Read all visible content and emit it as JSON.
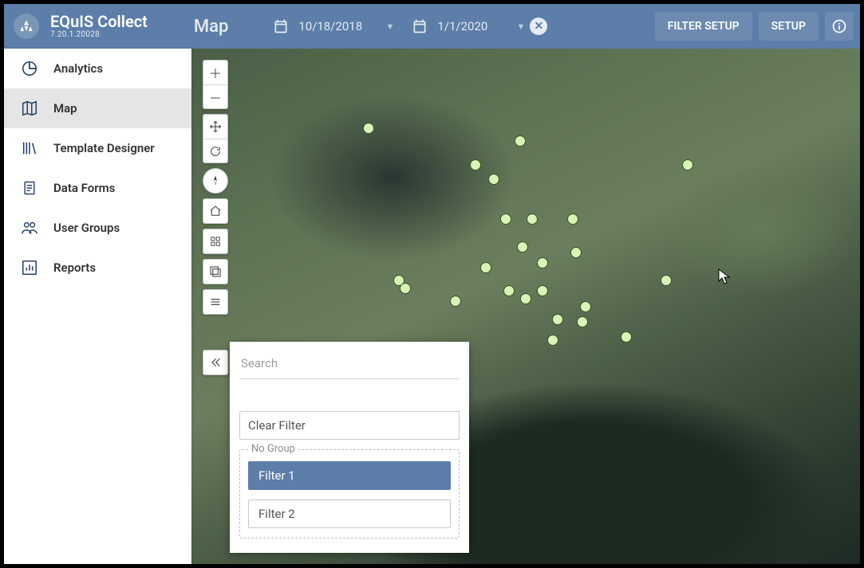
{
  "brand": {
    "name": "EQuIS Collect",
    "version": "7.20.1.20028"
  },
  "page_title": "Map",
  "dates": {
    "start": "10/18/2018",
    "end": "1/1/2020"
  },
  "header": {
    "filter_setup": "FILTER SETUP",
    "setup": "SETUP"
  },
  "sidebar": {
    "items": [
      {
        "label": "Analytics"
      },
      {
        "label": "Map"
      },
      {
        "label": "Template Designer"
      },
      {
        "label": "Data Forms"
      },
      {
        "label": "User Groups"
      },
      {
        "label": "Reports"
      }
    ],
    "active_index": 1
  },
  "filter_panel": {
    "search_placeholder": "Search",
    "clear_label": "Clear Filter",
    "group_label": "No Group",
    "filters": [
      "Filter 1",
      "Filter 2"
    ],
    "selected_index": 0
  }
}
